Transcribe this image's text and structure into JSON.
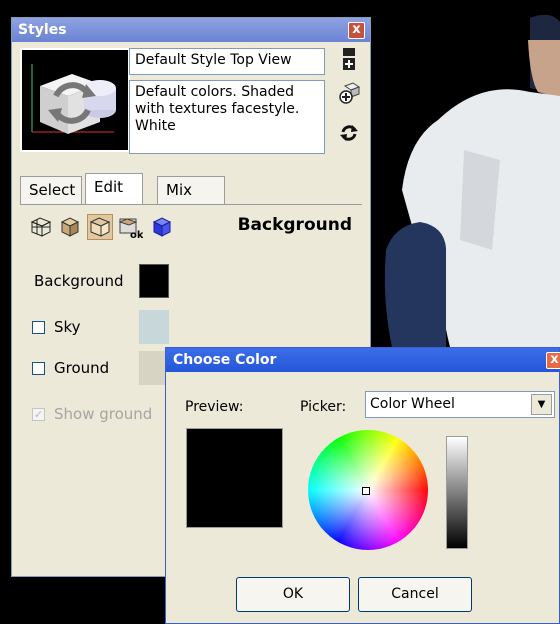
{
  "styles_panel": {
    "title": "Styles",
    "close_label": "x",
    "style_name": "Default Style Top View",
    "style_description": "Default colors.  Shaded with textures facestyle.  White",
    "tabs": [
      {
        "label": "Select",
        "active": false
      },
      {
        "label": "Edit",
        "active": true
      },
      {
        "label": "Mix",
        "active": false
      }
    ],
    "section_title": "Background",
    "toolbar_icons": [
      "edge-settings-icon",
      "face-settings-icon",
      "background-settings-icon",
      "watermark-settings-icon",
      "modeling-settings-icon"
    ],
    "background_label": "Background",
    "background_color": "#000000",
    "sky": {
      "label": "Sky",
      "checked": false,
      "color": "#c7d7da"
    },
    "ground": {
      "label": "Ground",
      "checked": false,
      "color": "#d7d4c4"
    },
    "show_ground": {
      "label": "Show ground",
      "checked": true,
      "disabled": true
    }
  },
  "choose_color_dialog": {
    "title": "Choose Color",
    "close_label": "x",
    "preview_label": "Preview:",
    "preview_color": "#000000",
    "picker_label": "Picker:",
    "picker_value": "Color Wheel",
    "ok_label": "OK",
    "cancel_label": "Cancel"
  }
}
